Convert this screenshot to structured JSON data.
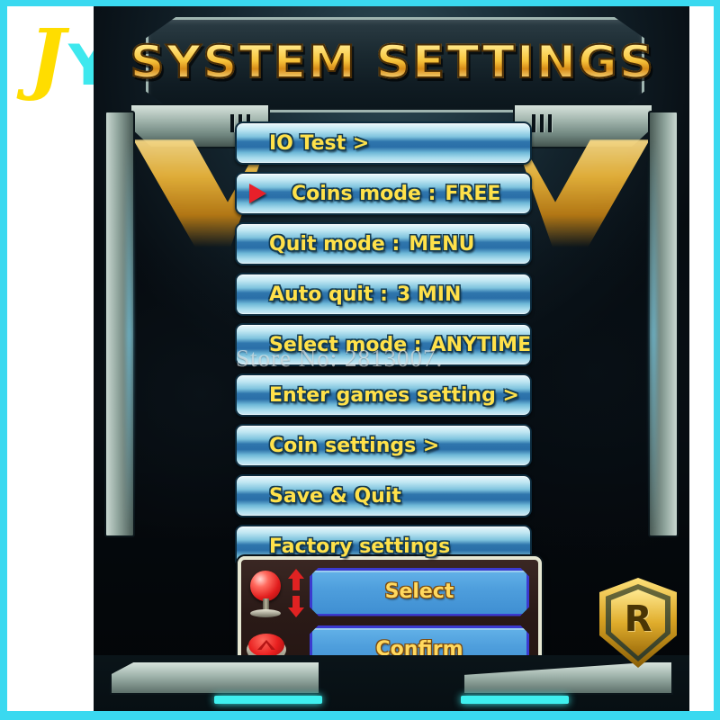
{
  "logo": {
    "first": "J",
    "second": "Y",
    "alt": "JY"
  },
  "screen": {
    "title": "SYSTEM SETTINGS",
    "watermark": "Store No: 2813007.",
    "emblem_letter": "R"
  },
  "menu": {
    "selected_index": 1,
    "items": [
      {
        "label": "IO Test >",
        "value": "",
        "has_cursor": false,
        "centered": false
      },
      {
        "label": "Coins mode :",
        "value": "FREE",
        "has_cursor": true,
        "centered": false
      },
      {
        "label": "Quit mode :",
        "value": "MENU",
        "has_cursor": false,
        "centered": false
      },
      {
        "label": "Auto quit :",
        "value": "3  MIN",
        "has_cursor": false,
        "centered": false
      },
      {
        "label": "Select mode :",
        "value": "ANYTIME",
        "has_cursor": false,
        "centered": false
      },
      {
        "label": "Enter games setting >",
        "value": "",
        "has_cursor": false,
        "centered": false
      },
      {
        "label": "Coin settings >",
        "value": "",
        "has_cursor": false,
        "centered": false
      },
      {
        "label": "Save & Quit",
        "value": "",
        "has_cursor": false,
        "centered": false
      },
      {
        "label": "Factory settings",
        "value": "",
        "has_cursor": false,
        "centered": false
      }
    ]
  },
  "controls": {
    "select_label": "Select",
    "confirm_label": "Confirm",
    "joystick_icon": "joystick-red-ball",
    "up_arrow_icon": "arrow-up-icon",
    "down_arrow_icon": "arrow-down-icon",
    "button_icon": "arcade-button-red"
  },
  "colors": {
    "frame_cyan": "#3ad9f0",
    "menu_text_gold": "#ffe14a",
    "menu_blue_mid": "#2f76ad",
    "cursor_red": "#e8202a",
    "action_button_blue": "#4f9fdd",
    "action_border_purple": "#3b3ad0",
    "title_gold": "#f6c23a",
    "logo_yellow": "#ffdd00",
    "logo_cyan": "#3ee8ee"
  }
}
